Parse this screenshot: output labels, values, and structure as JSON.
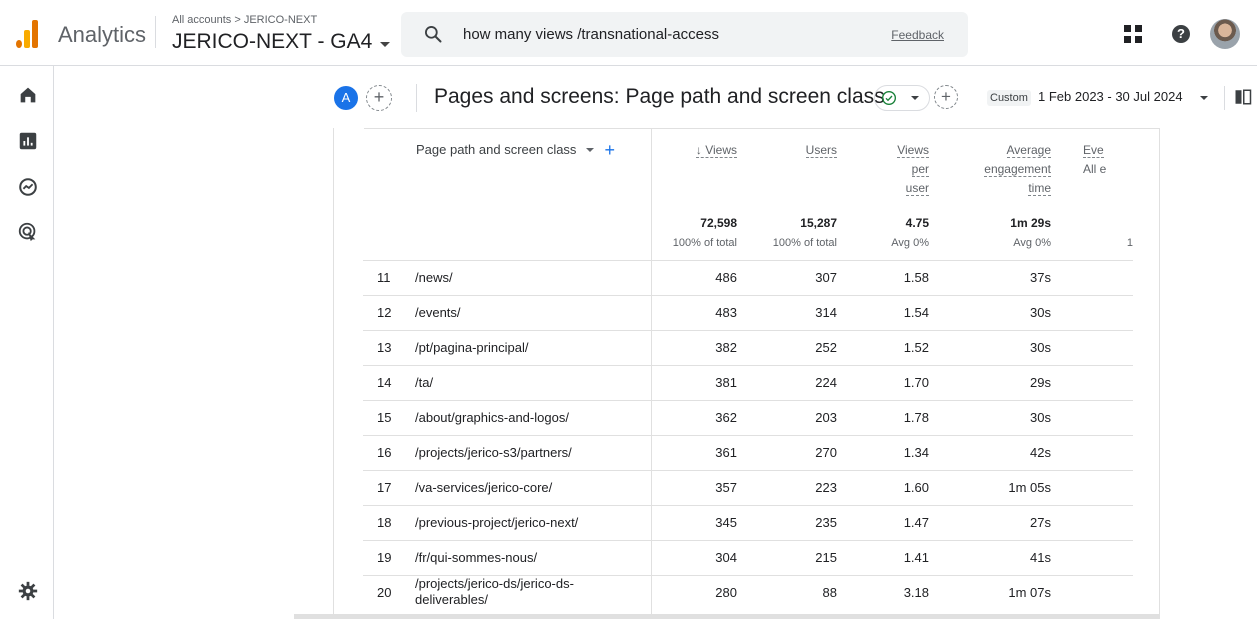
{
  "topbar": {
    "app_name": "Analytics",
    "account_crumb": "All accounts > JERICO-NEXT",
    "property_name": "JERICO-NEXT - GA4",
    "search_query": "how many views /transnational-access",
    "feedback_label": "Feedback",
    "help_glyph": "?",
    "icons": [
      "analytics-logo",
      "search-icon",
      "apps-grid-icon",
      "help-icon",
      "avatar"
    ]
  },
  "leftnav": {
    "icons": [
      "home-icon",
      "reports-icon",
      "explore-icon",
      "advertising-icon",
      "settings-icon"
    ]
  },
  "header": {
    "comparison_badge": "A",
    "add_comparison": "+",
    "title": "Pages and screens: Page path and screen class",
    "add_card": "+",
    "date_mode": "Custom",
    "date_range": "1 Feb 2023 - 30 Jul 2024"
  },
  "table": {
    "dimension_header": "Page path and screen class",
    "dimension_add": "+",
    "columns": [
      {
        "label": "↓ Views",
        "sorted": true
      },
      {
        "label": "Users"
      },
      {
        "label_lines": [
          "Views",
          "per",
          "user"
        ]
      },
      {
        "label_lines": [
          "Average",
          "engagement",
          "time"
        ]
      },
      {
        "label_lines": [
          "Eve",
          "All e"
        ]
      }
    ],
    "totals": {
      "views": "72,598",
      "views_sub": "100% of total",
      "users": "15,287",
      "users_sub": "100% of total",
      "vpu": "4.75",
      "vpu_sub": "Avg 0%",
      "aet": "1m 29s",
      "aet_sub": "Avg 0%",
      "events_sub": "1"
    },
    "rows": [
      {
        "n": "11",
        "path": "/news/",
        "views": "486",
        "users": "307",
        "vpu": "1.58",
        "aet": "37s"
      },
      {
        "n": "12",
        "path": "/events/",
        "views": "483",
        "users": "314",
        "vpu": "1.54",
        "aet": "30s"
      },
      {
        "n": "13",
        "path": "/pt/pagina-principal/",
        "views": "382",
        "users": "252",
        "vpu": "1.52",
        "aet": "30s"
      },
      {
        "n": "14",
        "path": "/ta/",
        "views": "381",
        "users": "224",
        "vpu": "1.70",
        "aet": "29s"
      },
      {
        "n": "15",
        "path": "/about/graphics-and-logos/",
        "views": "362",
        "users": "203",
        "vpu": "1.78",
        "aet": "30s"
      },
      {
        "n": "16",
        "path": "/projects/jerico-s3/partners/",
        "views": "361",
        "users": "270",
        "vpu": "1.34",
        "aet": "42s"
      },
      {
        "n": "17",
        "path": "/va-services/jerico-core/",
        "views": "357",
        "users": "223",
        "vpu": "1.60",
        "aet": "1m 05s"
      },
      {
        "n": "18",
        "path": "/previous-project/jerico-next/",
        "views": "345",
        "users": "235",
        "vpu": "1.47",
        "aet": "27s"
      },
      {
        "n": "19",
        "path": "/fr/qui-sommes-nous/",
        "views": "304",
        "users": "215",
        "vpu": "1.41",
        "aet": "41s"
      },
      {
        "n": "20",
        "path": "/projects/jerico-ds/jerico-ds-deliverables/",
        "views": "280",
        "users": "88",
        "vpu": "3.18",
        "aet": "1m 07s"
      }
    ]
  },
  "colors": {
    "accent": "#1a73e8",
    "logo_orange": "#e37400",
    "logo_yellow": "#f9ab00",
    "status_green": "#188038"
  }
}
